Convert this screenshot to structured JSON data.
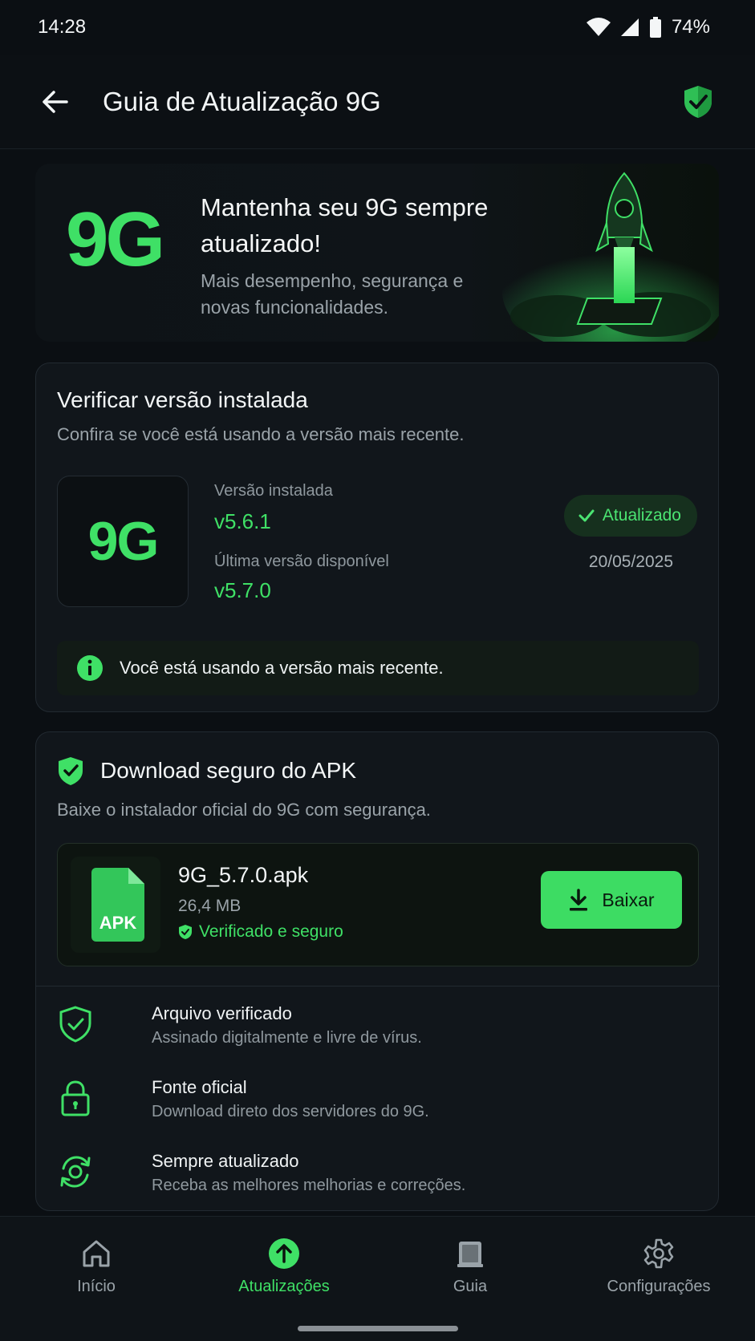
{
  "status_bar": {
    "time": "14:28",
    "battery": "74%"
  },
  "app_bar": {
    "title": "Guia de Atualização 9G"
  },
  "hero": {
    "logo": "9G",
    "title": "Mantenha seu 9G sempre atualizado!",
    "subtitle": "Mais desempenho, segurança e novas funcionalidades."
  },
  "version_card": {
    "title": "Verificar versão instalada",
    "subtitle": "Confira se você está usando a versão mais recente.",
    "app_logo": "9G",
    "installed_label": "Versão instalada",
    "installed_value": "v5.6.1",
    "latest_label": "Última versão disponível",
    "latest_value": "v5.7.0",
    "badge": "Atualizado",
    "date": "20/05/2025",
    "info": "Você está usando a versão mais recente."
  },
  "download_card": {
    "title": "Download seguro do APK",
    "subtitle": "Baixe o instalador oficial do 9G com segurança.",
    "apk_icon_label": "APK",
    "file_name": "9G_5.7.0.apk",
    "file_size": "26,4 MB",
    "verified": "Verificado e seguro",
    "download_label": "Baixar",
    "features": [
      {
        "title": "Arquivo verificado",
        "subtitle": "Assinado digitalmente e livre de vírus.",
        "icon": "shield-check-icon"
      },
      {
        "title": "Fonte oficial",
        "subtitle": "Download direto dos servidores do 9G.",
        "icon": "lock-icon"
      },
      {
        "title": "Sempre atualizado",
        "subtitle": "Receba as melhores melhorias e correções.",
        "icon": "refresh-icon"
      }
    ]
  },
  "bottom_nav": {
    "items": [
      {
        "label": "Início",
        "icon": "home-icon"
      },
      {
        "label": "Atualizações",
        "icon": "arrow-up-circle-icon",
        "active": true
      },
      {
        "label": "Guia",
        "icon": "book-icon"
      },
      {
        "label": "Configurações",
        "icon": "gear-icon"
      }
    ]
  },
  "colors": {
    "accent": "#3fe066",
    "background": "#0b0f13",
    "card": "#11161b"
  }
}
